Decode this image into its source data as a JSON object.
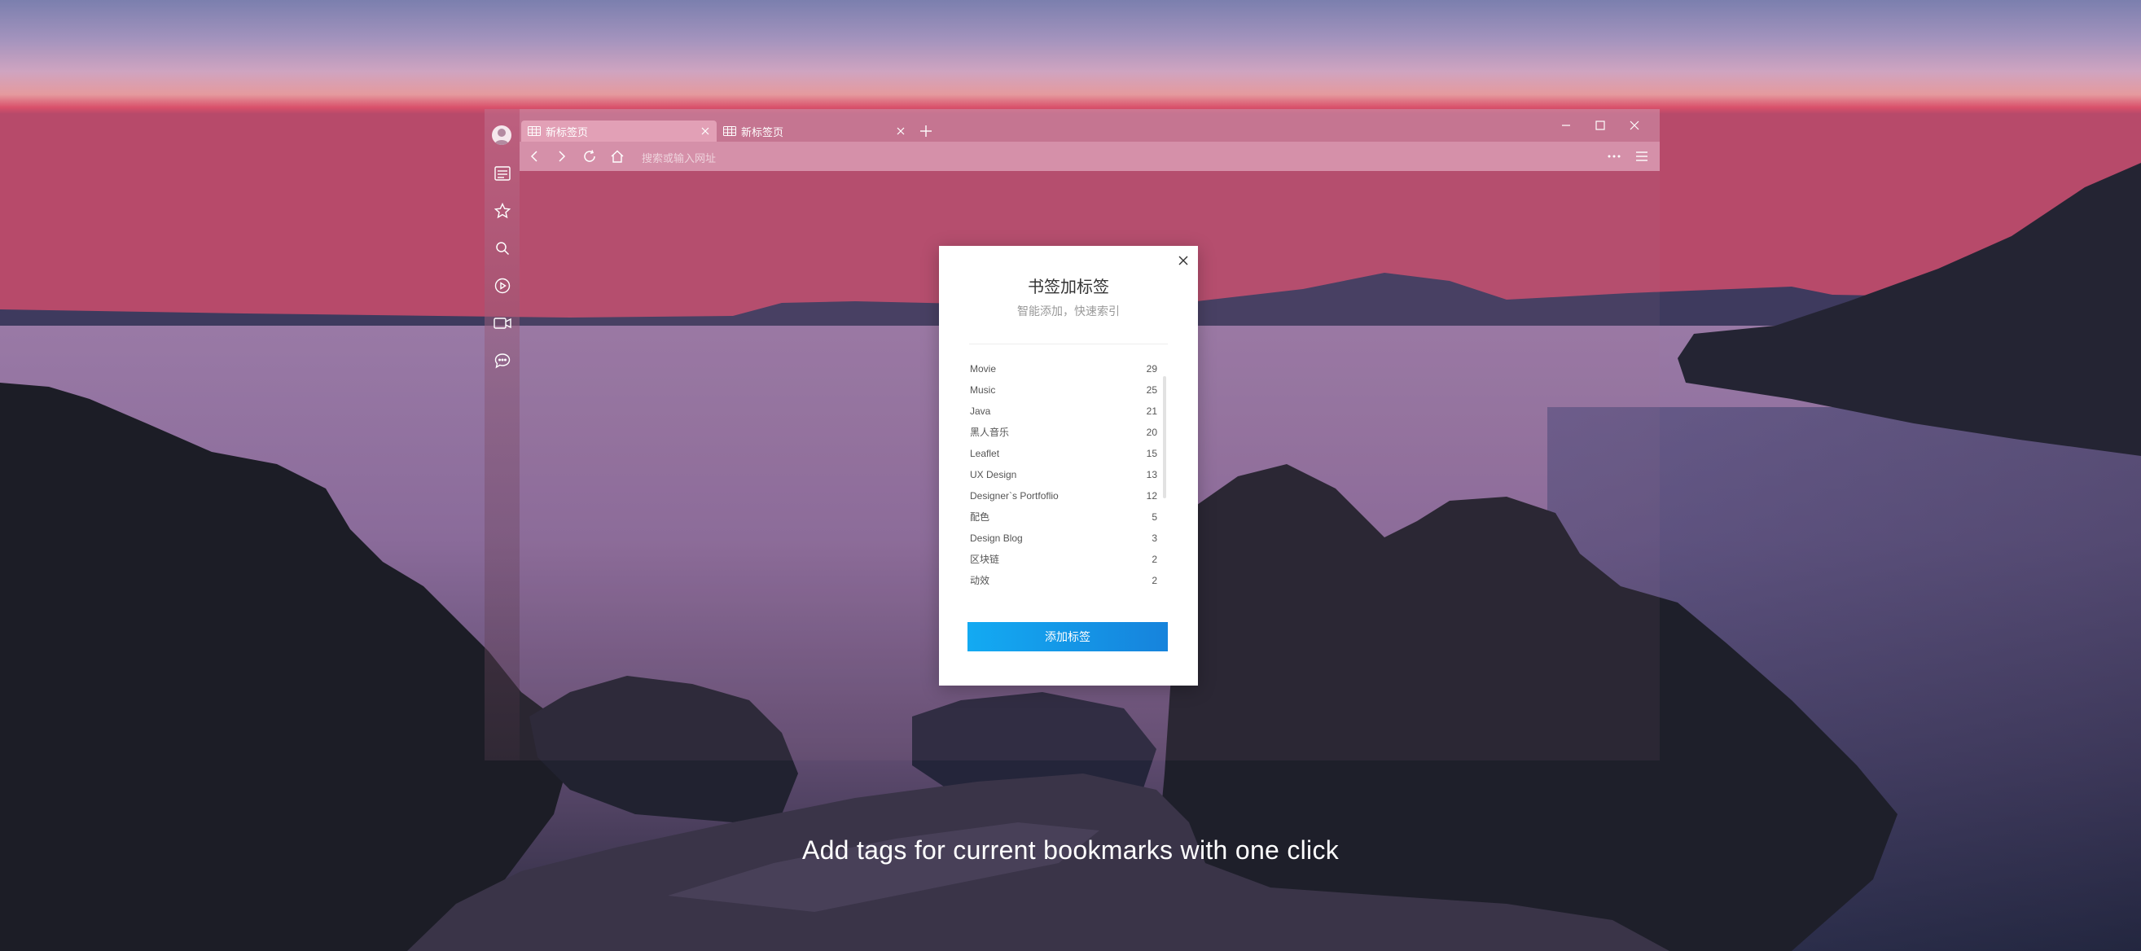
{
  "browser": {
    "tabs": [
      {
        "label": "新标签页",
        "active": true
      },
      {
        "label": "新标签页",
        "active": false
      }
    ],
    "address_placeholder": "搜索或输入网址"
  },
  "sidebar": {
    "icons": [
      "avatar",
      "reader-icon",
      "star-icon",
      "search-icon",
      "play-icon",
      "video-icon",
      "chat-icon"
    ]
  },
  "dialog": {
    "title": "书签加标签",
    "subtitle": "智能添加，快速索引",
    "tags": [
      {
        "name": "Movie",
        "count": "29"
      },
      {
        "name": "Music",
        "count": "25"
      },
      {
        "name": "Java",
        "count": "21"
      },
      {
        "name": "黑人音乐",
        "count": "20"
      },
      {
        "name": "Leaflet",
        "count": "15"
      },
      {
        "name": "UX Design",
        "count": "13"
      },
      {
        "name": "Designer`s Portfoflio",
        "count": "12"
      },
      {
        "name": "配色",
        "count": "5"
      },
      {
        "name": "Design Blog",
        "count": "3"
      },
      {
        "name": "区块链",
        "count": "2"
      },
      {
        "name": "动效",
        "count": "2"
      }
    ],
    "add_button": "添加标签"
  },
  "caption": "Add tags for current bookmarks with one click",
  "colors": {
    "accent_start": "#13aaf2",
    "accent_end": "#1683dc"
  }
}
